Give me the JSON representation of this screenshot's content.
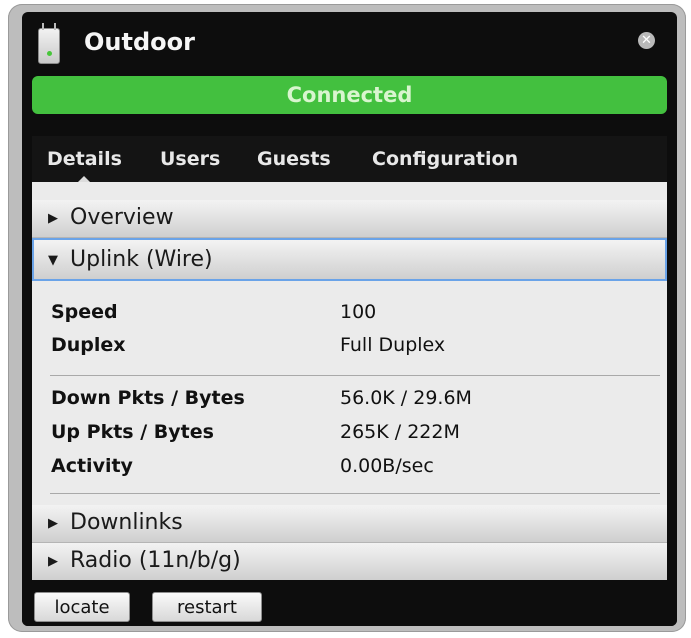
{
  "window": {
    "title": "Outdoor",
    "close_icon": "close-icon",
    "device_icon": "access-point-icon"
  },
  "status": {
    "text": "Connected",
    "color": "#43c03f"
  },
  "tabs": [
    {
      "label": "Details",
      "active": true
    },
    {
      "label": "Users",
      "active": false
    },
    {
      "label": "Guests",
      "active": false
    },
    {
      "label": "Configuration",
      "active": false
    }
  ],
  "sections": {
    "overview": {
      "label": "Overview",
      "expanded": false
    },
    "uplink": {
      "label": "Uplink (Wire)",
      "expanded": true
    },
    "downlinks": {
      "label": "Downlinks",
      "expanded": false
    },
    "radio": {
      "label": "Radio (11n/b/g)",
      "expanded": false
    }
  },
  "uplink_details": {
    "group1": [
      {
        "key": "Speed",
        "value": "100"
      },
      {
        "key": "Duplex",
        "value": "Full Duplex"
      }
    ],
    "group2": [
      {
        "key": "Down Pkts / Bytes",
        "value": "56.0K / 29.6M"
      },
      {
        "key": "Up Pkts / Bytes",
        "value": "265K / 222M"
      },
      {
        "key": "Activity",
        "value": "0.00B/sec"
      }
    ]
  },
  "footer": {
    "locate_label": "locate",
    "restart_label": "restart"
  },
  "colors": {
    "accent": "#43c03f",
    "panel_bg": "#0d0d0d",
    "content_bg": "#ebebeb",
    "focus": "#6aa3e8"
  }
}
